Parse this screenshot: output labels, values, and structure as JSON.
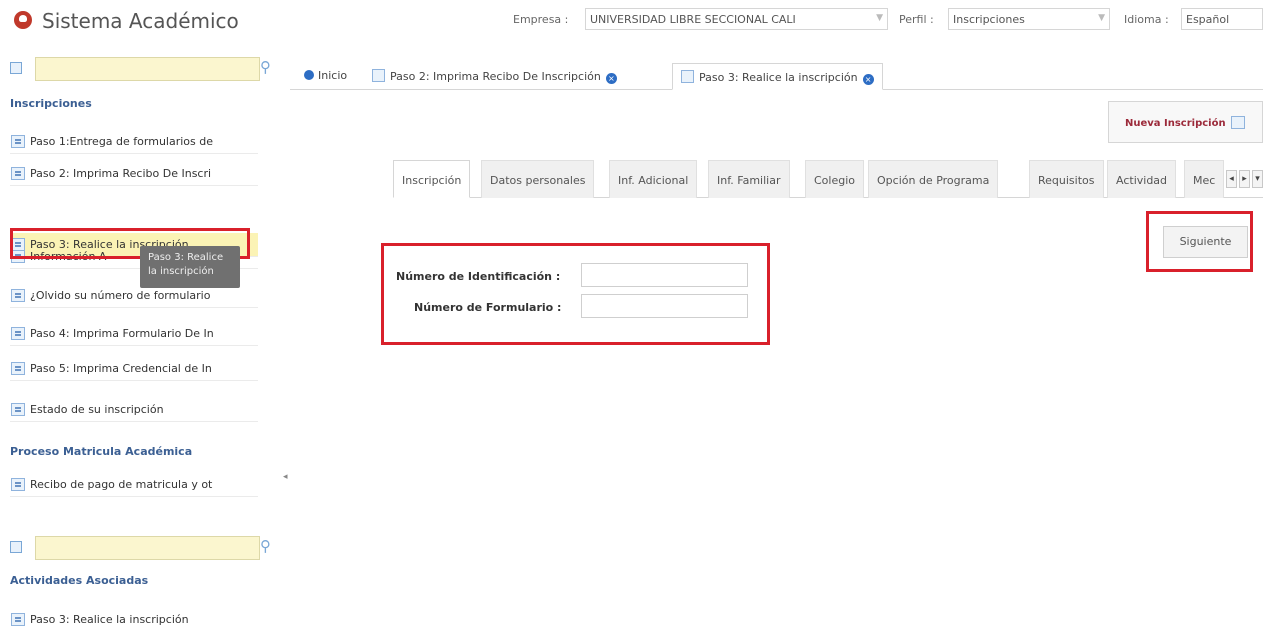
{
  "header": {
    "app_title": "Sistema Académico",
    "empresa_label": "Empresa :",
    "empresa_value": "UNIVERSIDAD LIBRE SECCIONAL CALI",
    "perfil_label": "Perfil :",
    "perfil_value": "Inscripciones",
    "idioma_label": "Idioma :",
    "idioma_value": "Español"
  },
  "sidebar": {
    "section1_title": "Inscripciones",
    "items": [
      {
        "label": "Paso 1:Entrega de formularios de"
      },
      {
        "label": "Paso 2: Imprima Recibo De Inscri"
      },
      {
        "label": "Paso 3: Realice la inscripción"
      },
      {
        "label": "Información A"
      },
      {
        "label": "¿Olvido su número de formulario"
      },
      {
        "label": "Paso 4: Imprima Formulario De In"
      },
      {
        "label": "Paso 5: Imprima Credencial de In"
      },
      {
        "label": "Estado de su inscripción"
      }
    ],
    "section2_title": "Proceso Matricula Académica",
    "items2": [
      {
        "label": "Recibo de pago de matricula y ot"
      }
    ],
    "section3_title": "Actividades Asociadas",
    "items3": [
      {
        "label": "Paso 3: Realice la inscripción"
      }
    ],
    "tooltip": "Paso 3: Realice la inscripción"
  },
  "tabs": {
    "inicio": "Inicio",
    "paso2": "Paso 2: Imprima Recibo De Inscripción",
    "paso3": "Paso 3: Realice la inscripción"
  },
  "main": {
    "nueva_label": "Nueva Inscripción",
    "subtabs": [
      "Inscripción",
      "Datos personales",
      "Inf. Adicional",
      "Inf. Familiar",
      "Colegio",
      "Opción de Programa",
      "Requisitos",
      "Actividad",
      "Mec"
    ],
    "siguiente_label": "Siguiente",
    "form": {
      "identificacion_label": "Número de Identificación :",
      "identificacion_value": "",
      "formulario_label": "Número de Formulario :",
      "formulario_value": ""
    }
  },
  "colors": {
    "highlight_red": "#d9202b",
    "link_blue": "#3b5f93",
    "search_yellow": "#fbf6cf"
  }
}
